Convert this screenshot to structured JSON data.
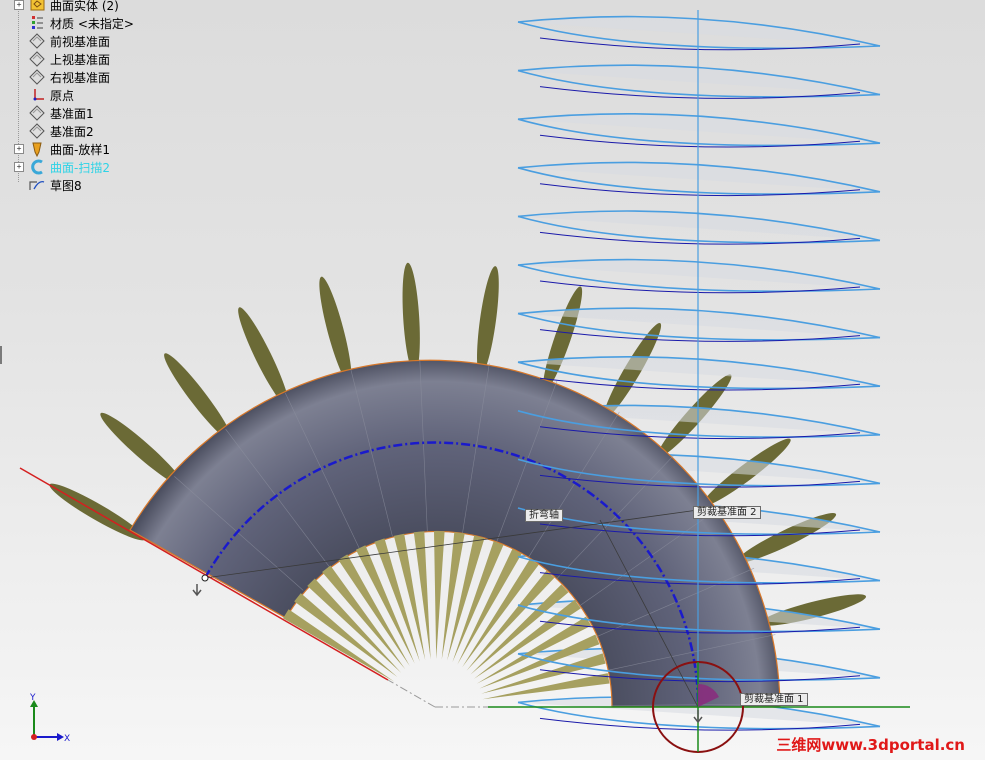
{
  "feature_tree": {
    "items": [
      {
        "label": "曲面实体 (2)",
        "icon": "surface-body-folder-icon",
        "expander": true,
        "highlight": false
      },
      {
        "label": "材质 <未指定>",
        "icon": "material-icon",
        "expander": false,
        "highlight": false
      },
      {
        "label": "前视基准面",
        "icon": "plane-icon",
        "expander": false,
        "highlight": false
      },
      {
        "label": "上视基准面",
        "icon": "plane-icon",
        "expander": false,
        "highlight": false
      },
      {
        "label": "右视基准面",
        "icon": "plane-icon",
        "expander": false,
        "highlight": false
      },
      {
        "label": "原点",
        "icon": "origin-icon",
        "expander": false,
        "highlight": false
      },
      {
        "label": "基准面1",
        "icon": "plane-icon",
        "expander": false,
        "highlight": false
      },
      {
        "label": "基准面2",
        "icon": "plane-icon",
        "expander": false,
        "highlight": false
      },
      {
        "label": "曲面-放样1",
        "icon": "surface-loft-icon",
        "expander": true,
        "highlight": false
      },
      {
        "label": "曲面-扫描2",
        "icon": "surface-sweep-icon",
        "expander": true,
        "highlight": true
      },
      {
        "label": "草图8",
        "icon": "sketch-icon",
        "expander": false,
        "highlight": false
      }
    ]
  },
  "viewport": {
    "labels": {
      "bend_plane": "折弯轴",
      "trim_plane_2": "剪裁基准面 2",
      "trim_plane_1": "剪裁基准面 1"
    },
    "axes": {
      "y": "Y",
      "x": "X"
    },
    "watermark": "三维网www.3dportal.cn",
    "colors": {
      "tube": "#5c5f72",
      "blades": "#6b6a36",
      "inner_blades": "#a6a060",
      "helix": "#4a9ee0",
      "centerline": "#1a1acc",
      "trim_line": "#d42020",
      "highlight": "#2fd3e6"
    }
  }
}
